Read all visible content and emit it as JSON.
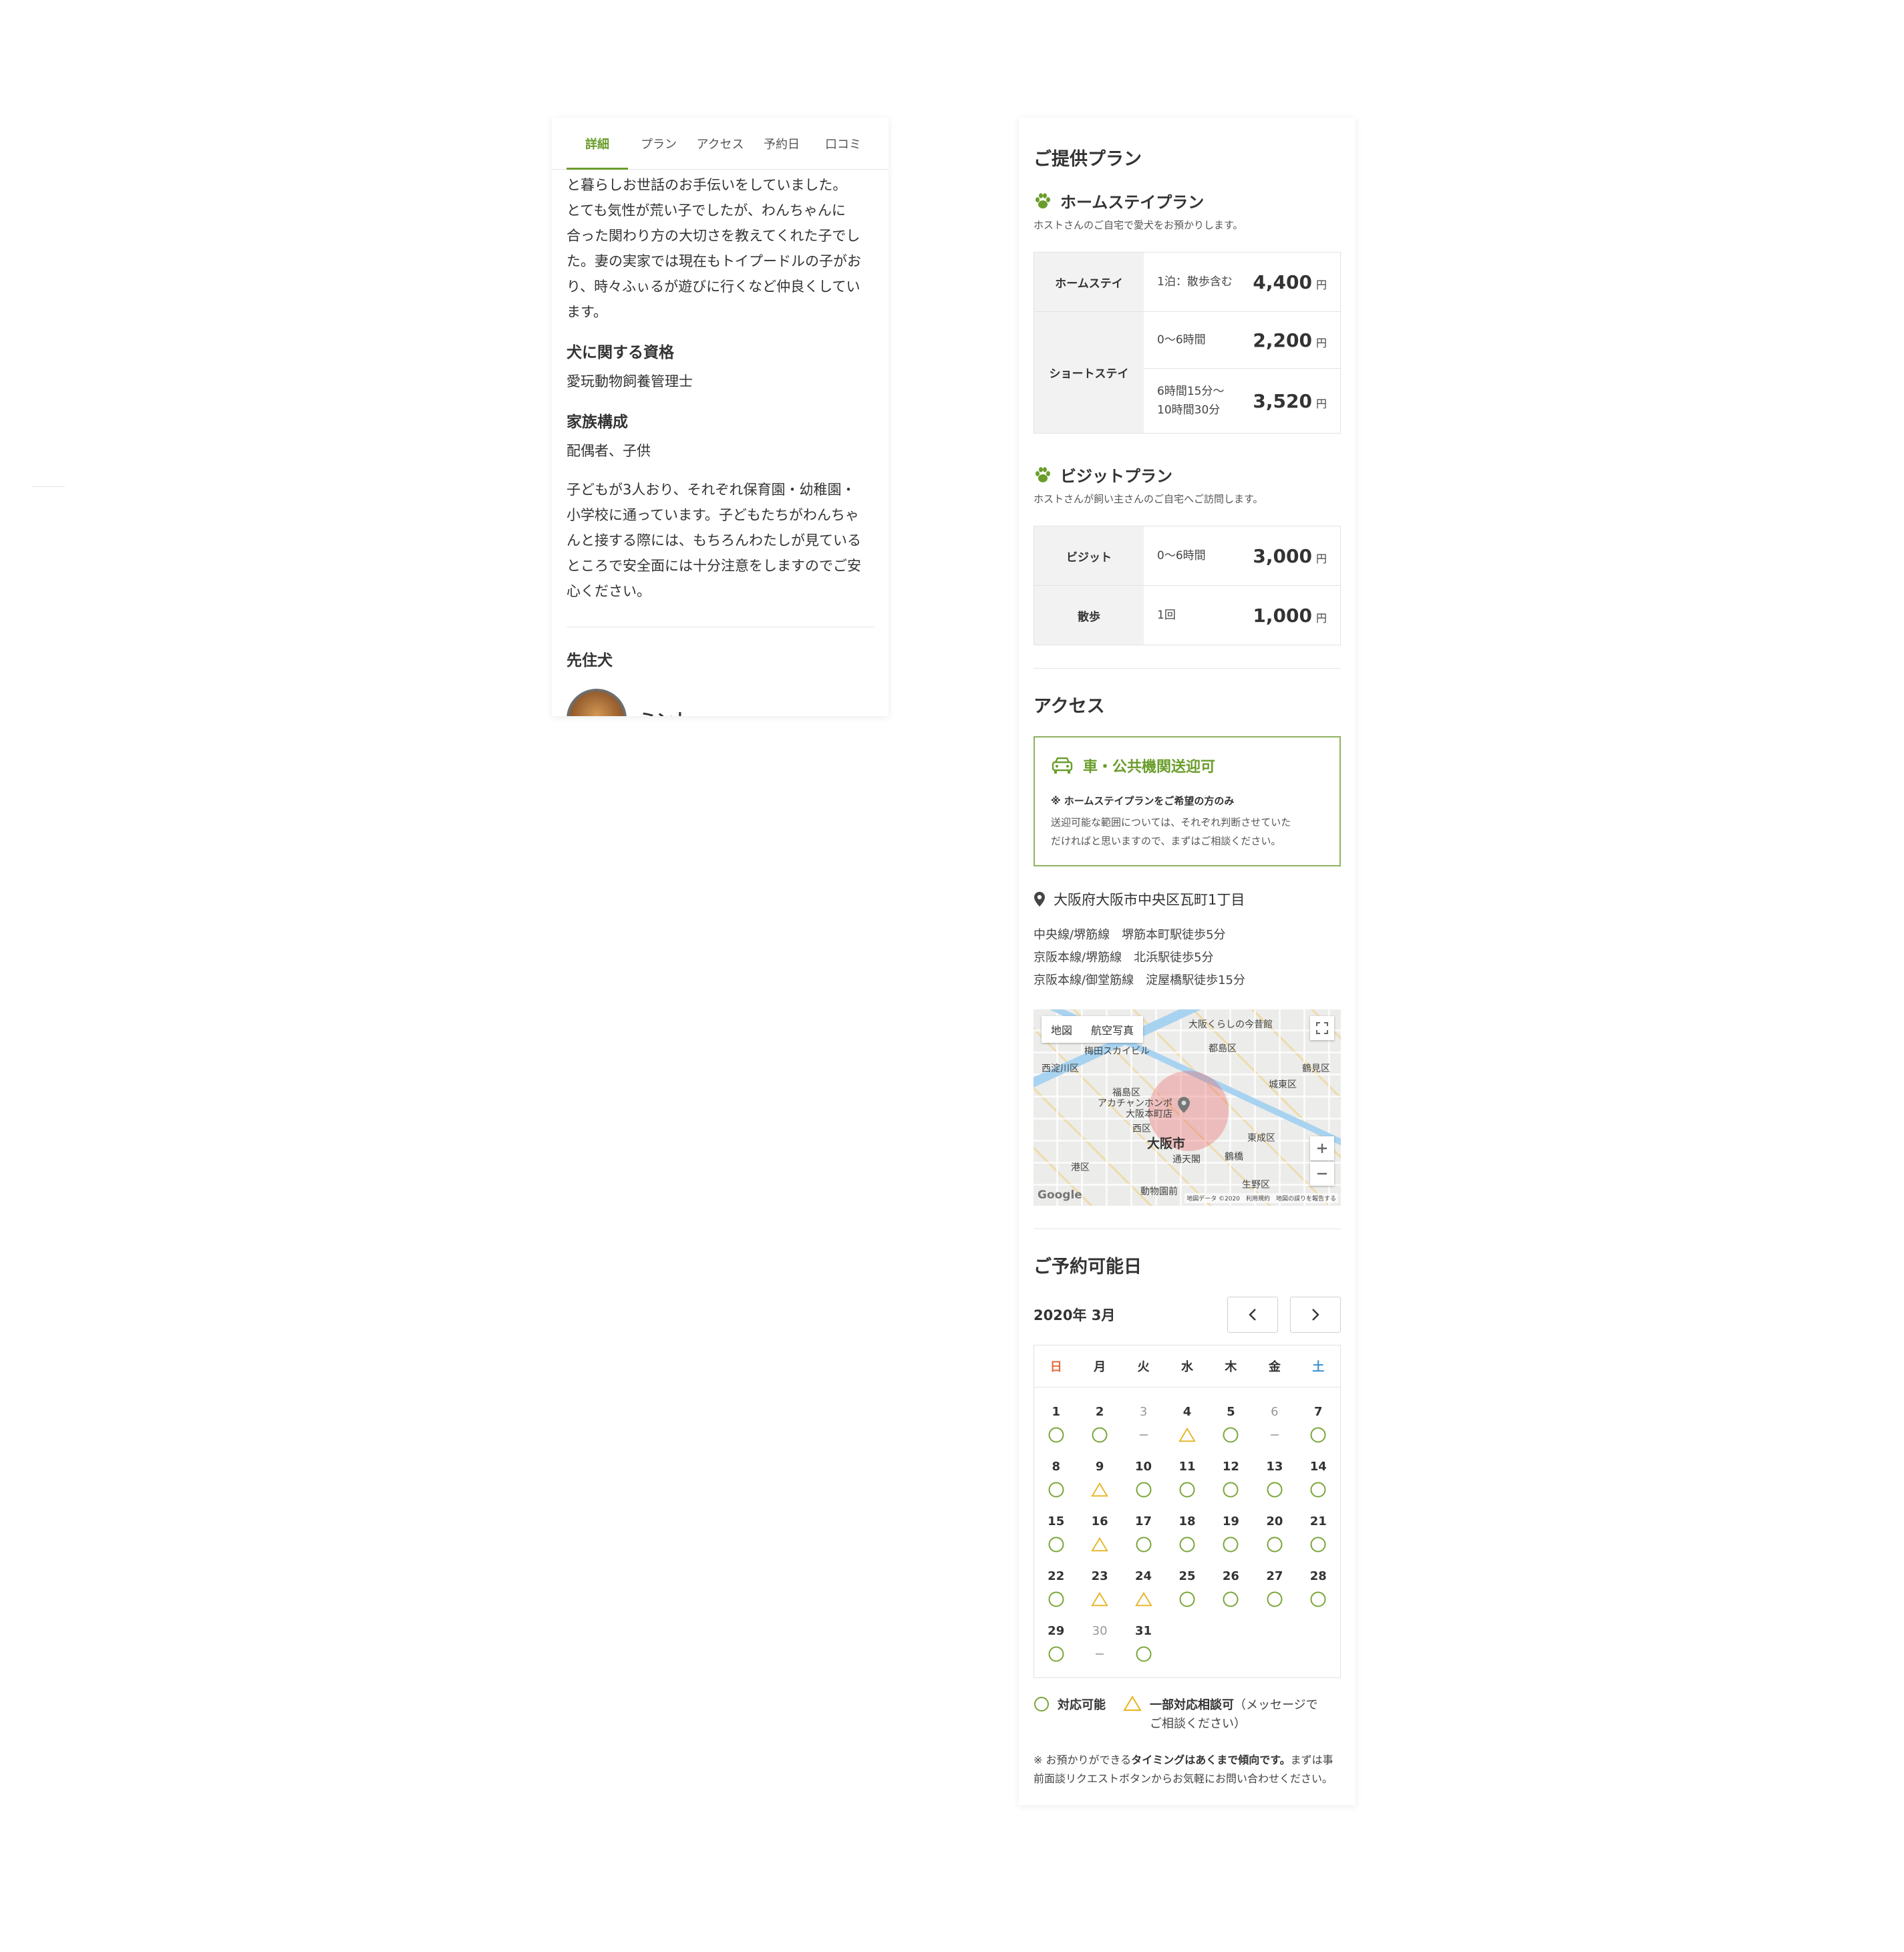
{
  "left": {
    "tabs": [
      "詳細",
      "プラン",
      "アクセス",
      "予約日",
      "口コミ"
    ],
    "intro_lines": [
      "と暮らしお世話のお手伝いをしていました。",
      "とても気性が荒い子でしたが、わんちゃんに",
      "合った関わり方の大切さを教えてくれた子でし",
      "た。妻の実家では現在もトイプードルの子がお",
      "り、時々ふぃるが遊びに行くなど仲良くしてい",
      "ます。"
    ],
    "cert_heading": "犬に関する資格",
    "cert_value": "愛玩動物飼養管理士",
    "family_heading": "家族構成",
    "family_value": "配偶者、子供",
    "family_lines": [
      "子どもが3人おり、それぞれ保育園・幼稚園・",
      "小学校に通っています。子どもたちがわんちゃ",
      "んと接する際には、もちろんわたしが見ている",
      "ところで安全面には十分注意をしますのでご安",
      "心ください。"
    ],
    "prev_dog_heading": "先住犬",
    "prev_dog_name": "ミント"
  },
  "plans": {
    "title": "ご提供プラン",
    "homestay": {
      "title": "ホームステイプラン",
      "desc": "ホストさんのご自宅で愛犬をお預かりします。",
      "rows": [
        {
          "name": "ホームステイ",
          "items": [
            {
              "desc": "1泊：散歩含む",
              "price": "4,400",
              "unit": "円"
            }
          ]
        },
        {
          "name": "ショートステイ",
          "items": [
            {
              "desc": "0〜6時間",
              "price": "2,200",
              "unit": "円"
            },
            {
              "desc": "6時間15分〜",
              "desc2": "10時間30分",
              "price": "3,520",
              "unit": "円"
            }
          ]
        }
      ]
    },
    "visit": {
      "title": "ビジットプラン",
      "desc": "ホストさんが飼い主さんのご自宅へご訪問します。",
      "rows": [
        {
          "name": "ビジット",
          "items": [
            {
              "desc": "0〜6時間",
              "price": "3,000",
              "unit": "円"
            }
          ]
        },
        {
          "name": "散歩",
          "items": [
            {
              "desc": "1回",
              "price": "1,000",
              "unit": "円"
            }
          ]
        }
      ]
    }
  },
  "access": {
    "title": "アクセス",
    "transport_title": "車・公共機関送迎可",
    "transport_note": "※ ホームステイプランをご希望の方のみ",
    "transport_desc_1": "送迎可能な範囲については、それぞれ判断させていた",
    "transport_desc_2": "だければと思いますので、まずはご相談ください。",
    "address": "大阪府大阪市中央区瓦町1丁目",
    "stations": [
      "中央線/堺筋線　堺筋本町駅徒歩5分",
      "京阪本線/堺筋線　北浜駅徒歩5分",
      "京阪本線/御堂筋線　淀屋橋駅徒歩15分"
    ],
    "map": {
      "toggle_map": "地図",
      "toggle_aerial": "航空写真",
      "city": "大阪市",
      "labels": [
        "大阪くらしの今昔館",
        "梅田スカイビル",
        "都島区",
        "西淀川区",
        "鶴見区",
        "福島区",
        "城東区",
        "アカチャンホンポ",
        "大阪本町店",
        "西区",
        "東成区",
        "港区",
        "生野区",
        "通天閣",
        "鶴橋",
        "動物園前"
      ],
      "google": "Google",
      "attribution": "地図データ ©2020　利用規約　地図の誤りを報告する"
    }
  },
  "calendar": {
    "title": "ご予約可能日",
    "month": "2020年 3月",
    "weekdays": [
      "日",
      "月",
      "火",
      "水",
      "木",
      "金",
      "土"
    ],
    "days": [
      {
        "d": "1",
        "s": "o"
      },
      {
        "d": "2",
        "s": "o"
      },
      {
        "d": "3",
        "s": "-"
      },
      {
        "d": "4",
        "s": "t"
      },
      {
        "d": "5",
        "s": "o"
      },
      {
        "d": "6",
        "s": "-"
      },
      {
        "d": "7",
        "s": "o"
      },
      {
        "d": "8",
        "s": "o"
      },
      {
        "d": "9",
        "s": "t"
      },
      {
        "d": "10",
        "s": "o"
      },
      {
        "d": "11",
        "s": "o"
      },
      {
        "d": "12",
        "s": "o"
      },
      {
        "d": "13",
        "s": "o"
      },
      {
        "d": "14",
        "s": "o"
      },
      {
        "d": "15",
        "s": "o"
      },
      {
        "d": "16",
        "s": "t"
      },
      {
        "d": "17",
        "s": "o"
      },
      {
        "d": "18",
        "s": "o"
      },
      {
        "d": "19",
        "s": "o"
      },
      {
        "d": "20",
        "s": "o"
      },
      {
        "d": "21",
        "s": "o"
      },
      {
        "d": "22",
        "s": "o"
      },
      {
        "d": "23",
        "s": "t"
      },
      {
        "d": "24",
        "s": "t"
      },
      {
        "d": "25",
        "s": "o"
      },
      {
        "d": "26",
        "s": "o"
      },
      {
        "d": "27",
        "s": "o"
      },
      {
        "d": "28",
        "s": "o"
      },
      {
        "d": "29",
        "s": "o"
      },
      {
        "d": "30",
        "s": "-"
      },
      {
        "d": "31",
        "s": "o"
      }
    ],
    "legend_available": "対応可能",
    "legend_partial": "一部対応相談可",
    "legend_partial_sub_1": "（メッセージで",
    "legend_partial_sub_2": "ご相談ください）",
    "note_prefix": "※ お預かりができる",
    "note_bold": "タイミングはあくまで傾向です。",
    "note_suffix_1": "まずは事",
    "note_suffix_2": "前面談リクエストボタンからお気軽にお問い合わせください。"
  },
  "colors": {
    "accent": "#6a9d2b",
    "circle": "#7aa63a",
    "triangle": "#e6b422",
    "sunday": "#e06b3c",
    "saturday": "#3b92d0"
  }
}
